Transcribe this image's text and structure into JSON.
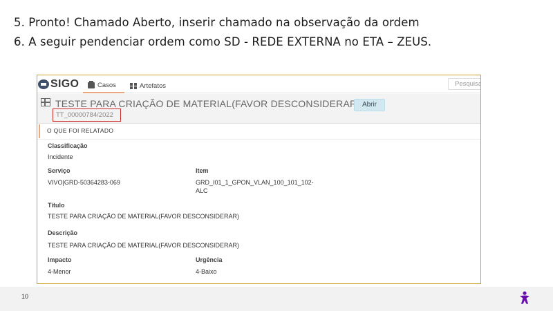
{
  "slide": {
    "step5": "5. Pronto! Chamado Aberto, inserir chamado na observação da ordem",
    "step6": "6. A seguir pendenciar ordem como SD - REDE EXTERNA no ETA – ZEUS.",
    "page_number": "10",
    "brand_icon": "figure-logo-icon",
    "brand_color": "#6a0dad"
  },
  "app": {
    "logo_text": "SIGO",
    "tabs": [
      {
        "label": "Casos",
        "icon": "cases-icon",
        "active": true
      },
      {
        "label": "Artefatos",
        "icon": "grid-icon",
        "active": false
      }
    ],
    "search_placeholder": "Pesquisa"
  },
  "case": {
    "title": "TESTE PARA CRIAÇÃO DE MATERIAL(FAVOR DESCONSIDERAR)",
    "open_button": "Abrir",
    "id": "TT_00000784/2022",
    "section_title": "O QUE FOI RELATADO",
    "fields": {
      "classificacao_label": "Classificação",
      "classificacao_value": "Incidente",
      "servico_label": "Serviço",
      "servico_value": "VIVO|GRD-50364283-069",
      "item_label": "Item",
      "item_value_line1": "GRD_I01_1_GPON_VLAN_100_101_102-",
      "item_value_line2": "ALC",
      "titulo_label": "Título",
      "titulo_value": "TESTE PARA CRIAÇÃO DE MATERIAL(FAVOR DESCONSIDERAR)",
      "descricao_label": "Descrição",
      "descricao_value": "TESTE PARA CRIAÇÃO DE MATERIAL(FAVOR DESCONSIDERAR)",
      "impacto_label": "Impacto",
      "impacto_value": "4-Menor",
      "urgencia_label": "Urgência",
      "urgencia_value": "4-Baixo"
    },
    "highlight_color": "#c82828",
    "accent_color": "#e8a87c"
  }
}
